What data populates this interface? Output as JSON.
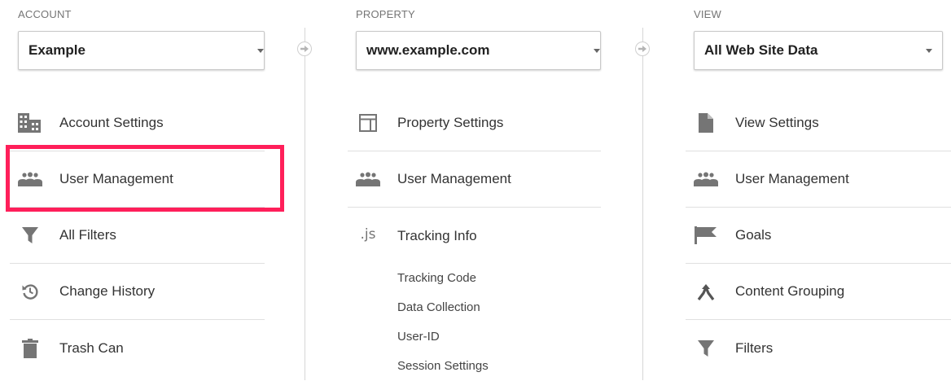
{
  "account": {
    "title": "ACCOUNT",
    "selected": "Example",
    "items": [
      {
        "label": "Account Settings",
        "icon": "building-icon"
      },
      {
        "label": "User Management",
        "icon": "users-icon"
      },
      {
        "label": "All Filters",
        "icon": "filter-icon"
      },
      {
        "label": "Change History",
        "icon": "history-icon"
      },
      {
        "label": "Trash Can",
        "icon": "trash-icon"
      }
    ]
  },
  "property": {
    "title": "PROPERTY",
    "selected": "www.example.com",
    "items": [
      {
        "label": "Property Settings",
        "icon": "layout-icon"
      },
      {
        "label": "User Management",
        "icon": "users-icon"
      },
      {
        "label": "Tracking Info",
        "icon": "js-icon",
        "icon_text": ".js"
      }
    ],
    "tracking_subitems": [
      "Tracking Code",
      "Data Collection",
      "User-ID",
      "Session Settings"
    ]
  },
  "view": {
    "title": "VIEW",
    "selected": "All Web Site Data",
    "items": [
      {
        "label": "View Settings",
        "icon": "document-icon"
      },
      {
        "label": "User Management",
        "icon": "users-icon"
      },
      {
        "label": "Goals",
        "icon": "flag-icon"
      },
      {
        "label": "Content Grouping",
        "icon": "content-grouping-icon"
      },
      {
        "label": "Filters",
        "icon": "filter-icon"
      }
    ]
  },
  "colors": {
    "highlight": "#ff1f5a",
    "icon": "#757575",
    "divider": "#e0e0e0"
  }
}
